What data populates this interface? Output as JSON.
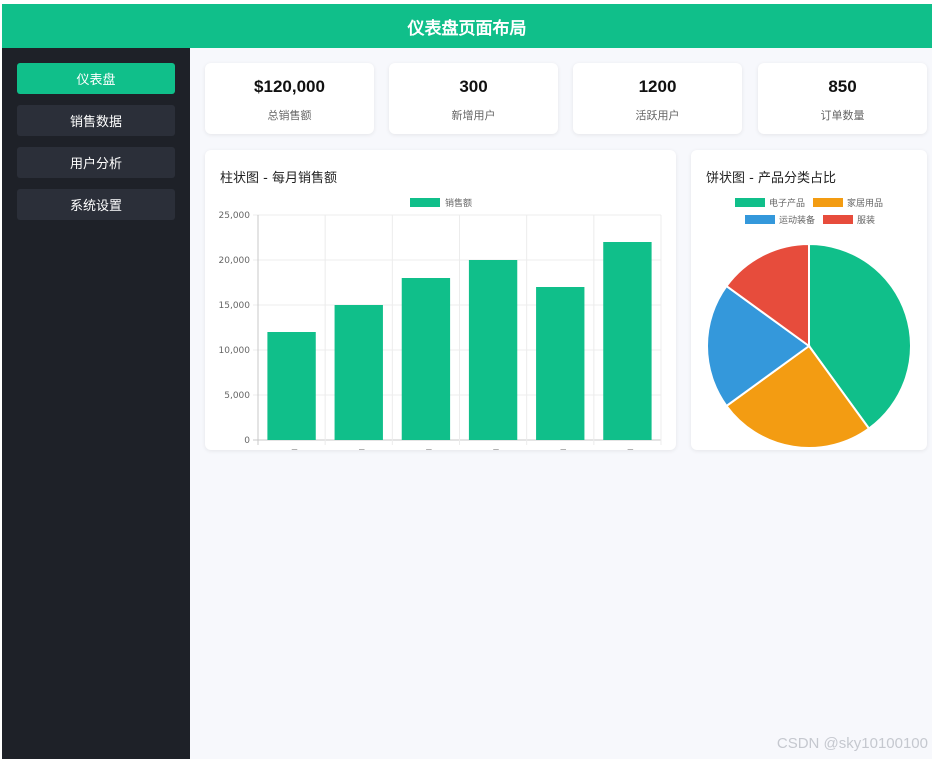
{
  "header": {
    "title": "仪表盘页面布局"
  },
  "sidebar": {
    "items": [
      {
        "label": "仪表盘"
      },
      {
        "label": "销售数据"
      },
      {
        "label": "用户分析"
      },
      {
        "label": "系统设置"
      }
    ]
  },
  "stats": [
    {
      "value": "$120,000",
      "label": "总销售额"
    },
    {
      "value": "300",
      "label": "新增用户"
    },
    {
      "value": "1200",
      "label": "活跃用户"
    },
    {
      "value": "850",
      "label": "订单数量"
    }
  ],
  "bar_panel": {
    "title": "柱状图 - 每月销售额"
  },
  "pie_panel": {
    "title": "饼状图 - 产品分类占比"
  },
  "watermark": "CSDN @sky10100100",
  "colors": {
    "accent": "#10bf8a",
    "sidebar": "#1e2128",
    "nav_item": "#2b2f39"
  },
  "chart_data": [
    {
      "type": "bar",
      "title": "柱状图 - 每月销售额",
      "categories": [
        "1月",
        "2月",
        "3月",
        "4月",
        "5月",
        "6月"
      ],
      "series": [
        {
          "name": "销售额",
          "values": [
            12000,
            15000,
            18000,
            20000,
            17000,
            22000
          ],
          "color": "#10bf8a"
        }
      ],
      "ylim": [
        0,
        25000
      ],
      "yticks": [
        "0",
        "5,000",
        "10,000",
        "15,000",
        "20,000",
        "25,000"
      ],
      "grid": true,
      "legend": "top"
    },
    {
      "type": "pie",
      "title": "饼状图 - 产品分类占比",
      "labels": [
        "电子产品",
        "家居用品",
        "运动装备",
        "服装"
      ],
      "values": [
        40,
        25,
        20,
        15
      ],
      "colors": [
        "#10bf8a",
        "#f39c12",
        "#3498db",
        "#e74c3c"
      ],
      "legend": "top"
    }
  ]
}
